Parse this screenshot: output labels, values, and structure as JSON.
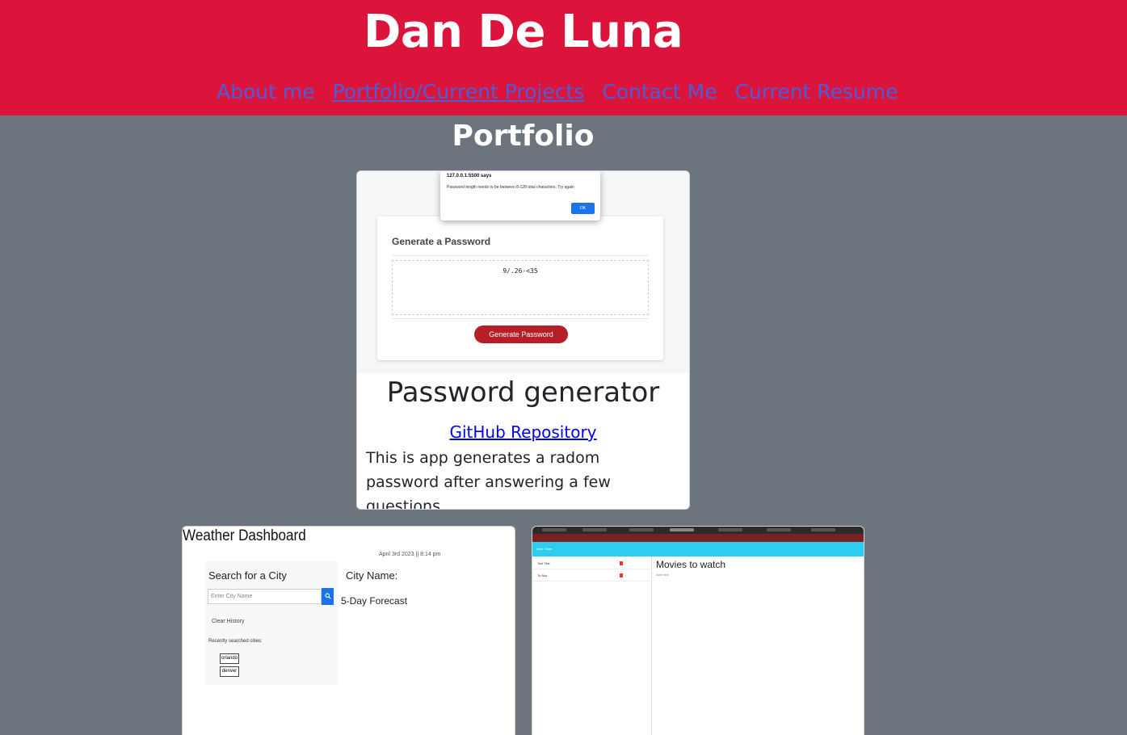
{
  "site": {
    "title": "Dan De Luna",
    "nav": [
      {
        "label": "About me",
        "active": false
      },
      {
        "label": "Portfolio/Current Projects",
        "active": true
      },
      {
        "label": "Contact Me",
        "active": false
      },
      {
        "label": "Current Resume",
        "active": false
      }
    ]
  },
  "colors": {
    "header_bg": "#dc143c",
    "page_bg": "#6c757d",
    "nav_link": "#4a5ed8"
  },
  "portfolio": {
    "heading": "Portfolio",
    "featured": {
      "title": "Password generator",
      "link_label": "GitHub Repository",
      "description": "This is app generates a radom password after answering a few questions.",
      "screenshot": {
        "dialog_title": "127.0.0.1:5500 says",
        "dialog_message": "Password length needs to  be between 8-128 total characters. Try again",
        "dialog_ok": "OK",
        "card_heading": "Generate a Password",
        "generated_password": "9/.26-<35",
        "button_label": "Generate Password"
      }
    },
    "weather": {
      "title": "Weather Dashboard",
      "date": "April 3rd 2023 || 8:14 pm",
      "search_title": "Search for a City",
      "input_placeholder": "Enter City Name",
      "search_icon": "magnifier-icon",
      "clear_label": "Clear History",
      "recent_label": "Recently searched cities:",
      "recent_cities": [
        "orlando",
        "denver"
      ],
      "city_name_label": "City Name:",
      "forecast_label": "5-Day Forecast"
    },
    "notes": {
      "app_bar": "Note Taker",
      "items": [
        "Test Title",
        "To Buy"
      ],
      "heading": "Movies to watch",
      "subtext": "Note text"
    }
  }
}
